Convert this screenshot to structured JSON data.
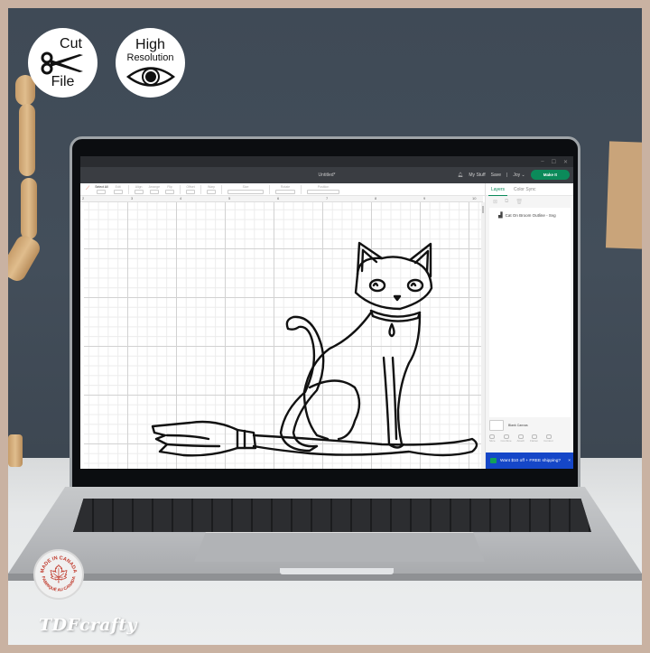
{
  "badges": {
    "cut_file": {
      "top": "Cut",
      "bottom": "File",
      "icon": "scissors-icon"
    },
    "high_res": {
      "line1": "High",
      "line2": "Resolution",
      "icon": "eye-icon"
    }
  },
  "window_controls": {
    "minimize": "–",
    "maximize": "☐",
    "close": "✕"
  },
  "app": {
    "document_title": "Untitled*",
    "header": {
      "notification_icon": "bell-icon",
      "my_stuff": "My Stuff",
      "save": "Save",
      "separator": "|",
      "user": "Joy",
      "make_it": "Make It"
    },
    "toolbar": {
      "items": [
        {
          "label": "Select All"
        },
        {
          "label": "Edit"
        },
        {
          "label": "Align"
        },
        {
          "label": "Arrange"
        },
        {
          "label": "Flip"
        },
        {
          "label": "Offset"
        },
        {
          "label": "Warp"
        },
        {
          "label": "Size"
        },
        {
          "label": "Rotate"
        },
        {
          "label": "Position"
        }
      ]
    },
    "ruler": [
      "2",
      "3",
      "4",
      "5",
      "6",
      "7",
      "8",
      "9",
      "10"
    ],
    "canvas": {
      "design": "Cat On Broom outline"
    },
    "panel": {
      "tabs": [
        {
          "label": "Layers",
          "active": true
        },
        {
          "label": "Color Sync",
          "active": false
        }
      ],
      "layers": [
        {
          "name": "Cat On Broom Outline - Svg",
          "icon": "layer-cut-icon"
        }
      ],
      "blank_canvas": "Blank Canvas",
      "actions": [
        "Slice",
        "Combine",
        "Attach",
        "Flatten",
        "Contour"
      ],
      "promo": {
        "text": "Want $10 off + FREE shipping?",
        "close": "×"
      }
    }
  },
  "seal": {
    "top": "MADE IN CANADA",
    "bottom": "FABRIQUÉ AU CANADA"
  },
  "brand": "TDFcrafty",
  "colors": {
    "border": "#c9b2a2",
    "accent_green": "#0b8a5a",
    "promo_blue": "#1547c8",
    "maple_red": "#c0392b"
  }
}
